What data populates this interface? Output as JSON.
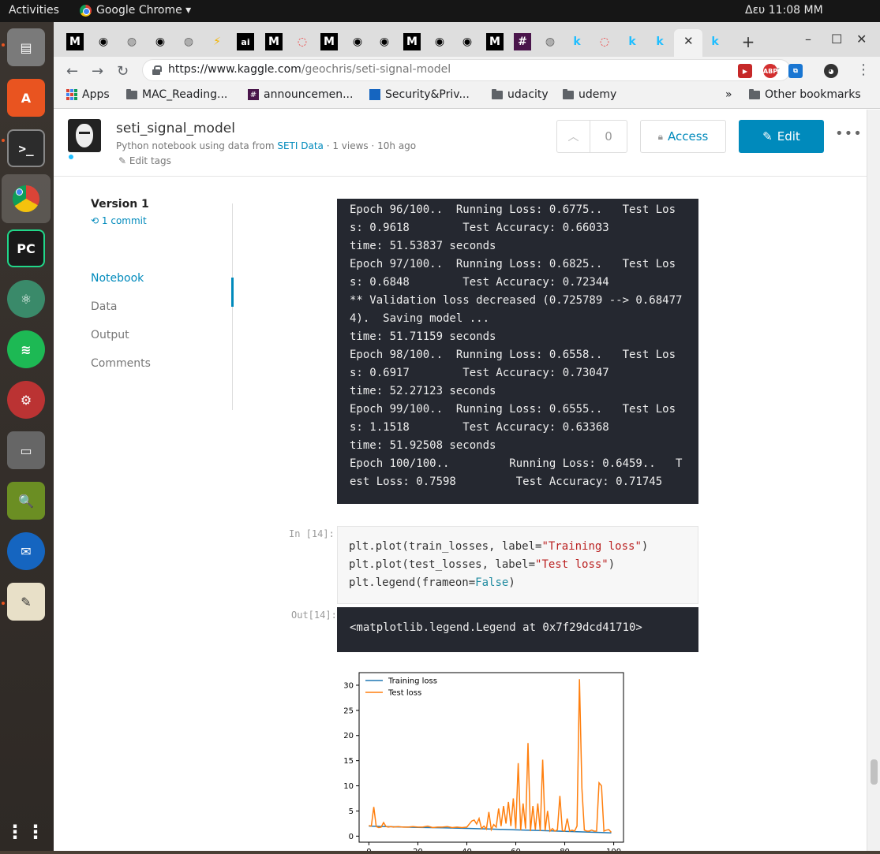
{
  "system": {
    "activities": "Activities",
    "app_name": "Google Chrome ▾",
    "clock": "Δευ 11:08 MM"
  },
  "browser": {
    "url_host": "https://www.kaggle.com",
    "url_path": "/geochris/seti-signal-model",
    "bookmarks": [
      "Apps",
      "MAC_Reading...",
      "announcemen...",
      "Security&Priv...",
      "udacity",
      "udemy",
      "»",
      "Other bookmarks"
    ]
  },
  "kernel": {
    "title": "seti_signal_model",
    "subtitle_prefix": "Python notebook using data from",
    "dataset_link": "SETI Data",
    "subtitle_suffix": "· 1 views · 10h ago",
    "edit_tags": "Edit tags",
    "vote_count": "0",
    "access_label": "Access",
    "edit_label": "Edit"
  },
  "sidebar": {
    "version": "Version 1",
    "commits": "1 commit",
    "items": [
      "Notebook",
      "Data",
      "Output",
      "Comments"
    ]
  },
  "training_output": [
    "Epoch 96/100..  Running Loss: 0.6775..   Test Los",
    "s: 0.9618        Test Accuracy: 0.66033",
    "time: 51.53837 seconds",
    "Epoch 97/100..  Running Loss: 0.6825..   Test Los",
    "s: 0.6848        Test Accuracy: 0.72344",
    "** Validation loss decreased (0.725789 --> 0.68477",
    "4).  Saving model ...",
    "time: 51.71159 seconds",
    "Epoch 98/100..  Running Loss: 0.6558..   Test Los",
    "s: 0.6917        Test Accuracy: 0.73047",
    "time: 52.27123 seconds",
    "Epoch 99/100..  Running Loss: 0.6555..   Test Los",
    "s: 1.1518        Test Accuracy: 0.63368",
    "time: 51.92508 seconds",
    "Epoch 100/100..         Running Loss: 0.6459..   T",
    "est Loss: 0.7598         Test Accuracy: 0.71745"
  ],
  "cell14": {
    "in_prompt": "In [14]:",
    "out_prompt": "Out[14]:",
    "line1_a": "plt.plot(train_losses, label=",
    "line1_s": "\"Training loss\"",
    "line1_b": ")",
    "line2_a": "plt.plot(test_losses, label=",
    "line2_s": "\"Test loss\"",
    "line2_b": ")",
    "line3_a": "plt.legend(frameon=",
    "line3_k": "False",
    "line3_b": ")",
    "output": "<matplotlib.legend.Legend at 0x7f29dcd41710>"
  },
  "chart_data": {
    "type": "line",
    "title": "",
    "xlabel": "",
    "ylabel": "",
    "xlim": [
      -4,
      104
    ],
    "ylim": [
      -1.2,
      32.5
    ],
    "xticks": [
      0,
      20,
      40,
      60,
      80,
      100
    ],
    "yticks": [
      0,
      5,
      10,
      15,
      20,
      25,
      30
    ],
    "legend_position": "top-left",
    "colors": {
      "train": "#1f77b4",
      "test": "#ff7f0e"
    },
    "series": [
      {
        "name": "Training loss",
        "x": [
          0,
          10,
          20,
          30,
          40,
          50,
          60,
          70,
          80,
          90,
          99
        ],
        "values": [
          2.0,
          1.85,
          1.75,
          1.65,
          1.55,
          1.4,
          1.25,
          1.1,
          0.95,
          0.8,
          0.65
        ]
      },
      {
        "name": "Test loss",
        "x": [
          0,
          1,
          2,
          3,
          4,
          5,
          6,
          7,
          8,
          9,
          10,
          12,
          14,
          16,
          18,
          20,
          22,
          24,
          26,
          28,
          30,
          32,
          34,
          36,
          38,
          40,
          42,
          43,
          44,
          45,
          46,
          47,
          48,
          49,
          50,
          51,
          52,
          53,
          54,
          55,
          56,
          57,
          58,
          59,
          60,
          61,
          62,
          63,
          64,
          65,
          66,
          67,
          68,
          69,
          70,
          71,
          72,
          73,
          74,
          75,
          76,
          77,
          78,
          79,
          80,
          81,
          82,
          83,
          84,
          85,
          86,
          87,
          88,
          89,
          90,
          91,
          92,
          93,
          94,
          95,
          96,
          97,
          98,
          99
        ],
        "values": [
          2.1,
          2.0,
          5.8,
          1.9,
          1.7,
          1.8,
          2.7,
          1.9,
          1.8,
          1.9,
          1.8,
          1.9,
          1.8,
          1.8,
          1.9,
          1.8,
          1.8,
          2.0,
          1.7,
          1.8,
          1.8,
          1.9,
          1.7,
          1.8,
          1.7,
          1.8,
          3.0,
          3.2,
          2.4,
          3.5,
          1.5,
          2.0,
          1.4,
          4.8,
          1.3,
          2.3,
          1.8,
          5.5,
          2.0,
          6.0,
          2.5,
          6.8,
          2.0,
          7.5,
          1.5,
          14.5,
          1.2,
          6.5,
          1.5,
          18.5,
          1.0,
          6.0,
          1.3,
          6.5,
          1.0,
          15.2,
          1.1,
          5.0,
          1.0,
          1.5,
          1.0,
          1.3,
          8.0,
          1.1,
          1.0,
          3.5,
          1.0,
          1.2,
          1.0,
          2.0,
          31.2,
          9.5,
          1.2,
          1.0,
          1.0,
          1.2,
          1.0,
          1.0,
          10.6,
          10.0,
          1.0,
          1.2,
          1.3,
          0.76
        ]
      }
    ]
  }
}
